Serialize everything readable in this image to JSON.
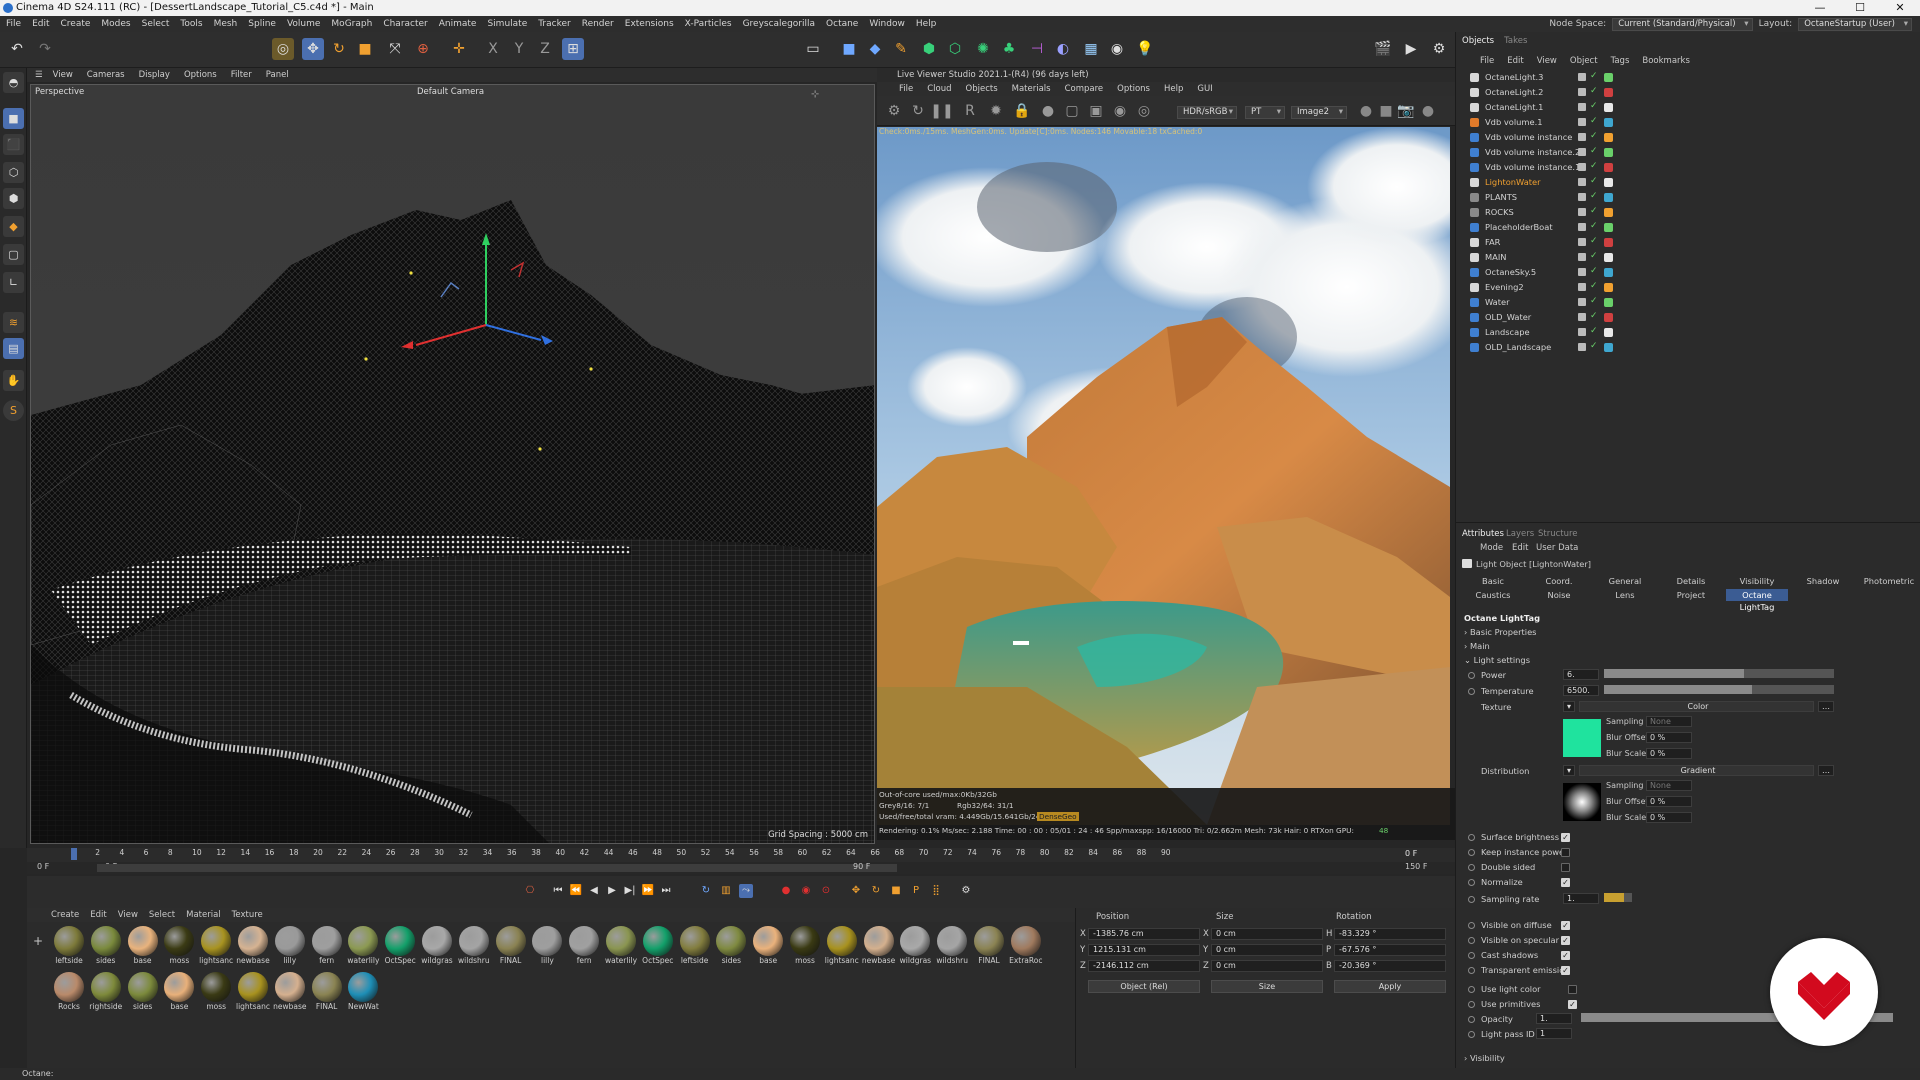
{
  "window": {
    "title": "Cinema 4D S24.111 (RC) - [DessertLandscape_Tutorial_C5.c4d *] - Main",
    "controls": [
      "—",
      "☐",
      "✕"
    ]
  },
  "menubar": {
    "items": [
      "File",
      "Edit",
      "Create",
      "Modes",
      "Select",
      "Tools",
      "Mesh",
      "Spline",
      "Volume",
      "MoGraph",
      "Character",
      "Animate",
      "Simulate",
      "Tracker",
      "Render",
      "Extensions",
      "X-Particles",
      "Greyscalegorilla",
      "Octane",
      "Window",
      "Help"
    ],
    "node_space_label": "Node Space:",
    "node_space_value": "Current (Standard/Physical)",
    "layout_label": "Layout:",
    "layout_value": "OctaneStartup (User)"
  },
  "viewport": {
    "menu": [
      "View",
      "Cameras",
      "Display",
      "Options",
      "Filter",
      "Panel"
    ],
    "mode": "Perspective",
    "camera": "Default Camera",
    "grid_spacing": "Grid Spacing : 5000 cm"
  },
  "live_viewer": {
    "title": "Live Viewer Studio 2021.1-(R4) (96 days left)",
    "menu": [
      "File",
      "Cloud",
      "Objects",
      "Materials",
      "Compare",
      "Options",
      "Help",
      "GUI"
    ],
    "colorspace": "HDR/sRGB",
    "kernel": "PT",
    "image": "Image2",
    "status": "Check:0ms./15ms. MeshGen:0ms. Update[C]:0ms. Nodes:146 Movable:18 txCached:0",
    "info1": "Out-of-core used/max:0Kb/32Gb",
    "info2": "Grey8/16: 7/1",
    "info3": "Rgb32/64: 31/1",
    "info4": "Used/free/total vram: 4.449Gb/15.641Gb/24Gb",
    "info5": "DenseGeo",
    "rendering": "Rendering: 0.1%  Ms/sec: 2.188  Time: 00 : 00 : 05/01 : 24 : 46  Spp/maxspp: 16/16000  Tri: 0/2.662m  Mesh: 73k  Hair: 0  RTXon  GPU:",
    "gpu": "48"
  },
  "timeline": {
    "ticks": [
      "0",
      "2",
      "4",
      "6",
      "8",
      "10",
      "12",
      "14",
      "16",
      "18",
      "20",
      "22",
      "24",
      "26",
      "28",
      "30",
      "32",
      "34",
      "36",
      "38",
      "40",
      "42",
      "44",
      "46",
      "48",
      "50",
      "52",
      "54",
      "56",
      "58",
      "60",
      "62",
      "64",
      "66",
      "68",
      "70",
      "72",
      "74",
      "76",
      "78",
      "80",
      "82",
      "84",
      "86",
      "88",
      "90"
    ],
    "current_frame": "0 F",
    "start": "0 F",
    "range_start": "0 F",
    "range_end": "90 F",
    "end": "150 F"
  },
  "materials": {
    "menu": [
      "Create",
      "Edit",
      "View",
      "Select",
      "Material",
      "Texture"
    ],
    "row1": [
      {
        "name": "leftside",
        "color": "#7d7a3a"
      },
      {
        "name": "sides",
        "color": "#7a8a3c"
      },
      {
        "name": "base",
        "color": "#e9b37d"
      },
      {
        "name": "moss",
        "color": "#3b3b14"
      },
      {
        "name": "lightsanc",
        "color": "#a89320"
      },
      {
        "name": "newbase",
        "color": "#d6b392"
      },
      {
        "name": "lilly",
        "color": "#9a9a9a"
      },
      {
        "name": "fern",
        "color": "#9e9e9e"
      },
      {
        "name": "waterlily",
        "color": "#8c9a52"
      },
      {
        "name": "OctSpec",
        "color": "#13a06a"
      },
      {
        "name": "wildgras",
        "color": "#a8a8a8"
      },
      {
        "name": "wildshru",
        "color": "#a4a4a4"
      },
      {
        "name": "FINAL",
        "color": "#8a8252"
      },
      {
        "name": "lilly",
        "color": "#9e9e9e"
      },
      {
        "name": "fern",
        "color": "#a0a0a0"
      },
      {
        "name": "waterlily",
        "color": "#8a9550"
      },
      {
        "name": "OctSpec",
        "color": "#12a06a"
      },
      {
        "name": "leftside",
        "color": "#827d3e"
      },
      {
        "name": "sides",
        "color": "#7f8a40"
      },
      {
        "name": "base",
        "color": "#eab27c"
      },
      {
        "name": "moss",
        "color": "#3a3a13"
      },
      {
        "name": "lightsanc",
        "color": "#a8921e"
      },
      {
        "name": "newbase",
        "color": "#d4b08e"
      },
      {
        "name": "wildgras",
        "color": "#a9a9a9"
      },
      {
        "name": "wildshru",
        "color": "#a5a5a5"
      },
      {
        "name": "FINAL",
        "color": "#8b8353"
      },
      {
        "name": "ExtraRoc",
        "color": "#a07a5e"
      }
    ],
    "row2": [
      {
        "name": "Rocks",
        "color": "#b98a6a"
      },
      {
        "name": "rightside",
        "color": "#7e8a3b"
      },
      {
        "name": "sides",
        "color": "#7c8a3c"
      },
      {
        "name": "base",
        "color": "#e8b07a"
      },
      {
        "name": "moss",
        "color": "#3a3a14"
      },
      {
        "name": "lightsanc",
        "color": "#a8921f"
      },
      {
        "name": "newbase",
        "color": "#d5b08f"
      },
      {
        "name": "FINAL",
        "color": "#8a8352"
      },
      {
        "name": "NewWat",
        "color": "#1e8fb7"
      }
    ]
  },
  "coords": {
    "headers": [
      "Position",
      "Size",
      "Rotation"
    ],
    "rows": [
      {
        "axis": "X",
        "pos": "-1385.76 cm",
        "size_axis": "X",
        "size": "0 cm",
        "rot_axis": "H",
        "rot": "-83.329 °"
      },
      {
        "axis": "Y",
        "pos": "1215.131 cm",
        "size_axis": "Y",
        "size": "0 cm",
        "rot_axis": "P",
        "rot": "-67.576 °"
      },
      {
        "axis": "Z",
        "pos": "-2146.112 cm",
        "size_axis": "Z",
        "size": "0 cm",
        "rot_axis": "B",
        "rot": "-20.369 °"
      }
    ],
    "mode": "Object (Rel)",
    "size_mode": "Size",
    "apply": "Apply"
  },
  "objects": {
    "tabs": [
      "Objects",
      "Takes"
    ],
    "menu": [
      "File",
      "Edit",
      "View",
      "Object",
      "Tags",
      "Bookmarks"
    ],
    "items": [
      {
        "name": "OctaneLight.3",
        "icon": "#d8d8d8"
      },
      {
        "name": "OctaneLight.2",
        "icon": "#d8d8d8"
      },
      {
        "name": "OctaneLight.1",
        "icon": "#d8d8d8"
      },
      {
        "name": "Vdb volume.1",
        "icon": "#e07a2a"
      },
      {
        "name": "Vdb volume instance",
        "icon": "#3f7fd0"
      },
      {
        "name": "Vdb volume instance.2",
        "icon": "#3f7fd0"
      },
      {
        "name": "Vdb volume instance.1",
        "icon": "#3f7fd0"
      },
      {
        "name": "LightonWater",
        "icon": "#d8d8d8",
        "highlight": true
      },
      {
        "name": "PLANTS",
        "icon": "#8a8a8a"
      },
      {
        "name": "ROCKS",
        "icon": "#8a8a8a"
      },
      {
        "name": "PlaceholderBoat",
        "icon": "#3f7fd0"
      },
      {
        "name": "FAR",
        "icon": "#d8d8d8"
      },
      {
        "name": "MAIN",
        "icon": "#d8d8d8"
      },
      {
        "name": "OctaneSky.5",
        "icon": "#3f7fd0"
      },
      {
        "name": "Evening2",
        "icon": "#d8d8d8"
      },
      {
        "name": "Water",
        "icon": "#3f7fd0"
      },
      {
        "name": "OLD_Water",
        "icon": "#3f7fd0"
      },
      {
        "name": "Landscape",
        "icon": "#3f7fd0"
      },
      {
        "name": "OLD_Landscape",
        "icon": "#3f7fd0"
      }
    ]
  },
  "attributes": {
    "tabs": [
      "Attributes",
      "Layers",
      "Structure"
    ],
    "menu": [
      "Mode",
      "Edit",
      "User Data"
    ],
    "object": "Light Object [LightonWater]",
    "tabs_row1": [
      "Basic",
      "Coord.",
      "General",
      "Details",
      "Visibility",
      "Shadow",
      "Photometric"
    ],
    "tabs_row2": [
      "Caustics",
      "Noise",
      "Lens",
      "Project",
      "Octane LightTag"
    ],
    "section": "Octane LightTag",
    "basic_properties": "Basic Properties",
    "main": "Main",
    "light_settings": "Light settings",
    "power_label": "Power",
    "power": "6.",
    "temperature_label": "Temperature",
    "temperature": "6500.",
    "texture_label": "Texture",
    "texture_value": "Color",
    "texture_color": "#1fe39e",
    "sampling_label": "Sampling",
    "sampling_value": "None",
    "blur_offset_label": "Blur Offset",
    "blur_offset": "0 %",
    "blur_scale_label": "Blur Scale",
    "blur_scale": "0 %",
    "distribution_label": "Distribution",
    "distribution_value": "Gradient",
    "checks": [
      {
        "label": "Surface brightness",
        "checked": true
      },
      {
        "label": "Keep instance power",
        "checked": false
      },
      {
        "label": "Double sided",
        "checked": false
      },
      {
        "label": "Normalize",
        "checked": true
      }
    ],
    "sampling_rate_label": "Sampling rate",
    "sampling_rate": "1.",
    "vis": [
      {
        "label": "Visible on diffuse",
        "checked": true
      },
      {
        "label": "Visible on specular",
        "checked": true
      },
      {
        "label": "Cast shadows",
        "checked": true
      },
      {
        "label": "Transparent emission",
        "checked": true
      }
    ],
    "use_light_color": "Use light color",
    "use_primitives": "Use primitives",
    "opacity_label": "Opacity",
    "opacity": "1.",
    "light_pass_label": "Light pass ID",
    "light_pass": "1",
    "visibility": "Visibility"
  },
  "status": "Octane:"
}
